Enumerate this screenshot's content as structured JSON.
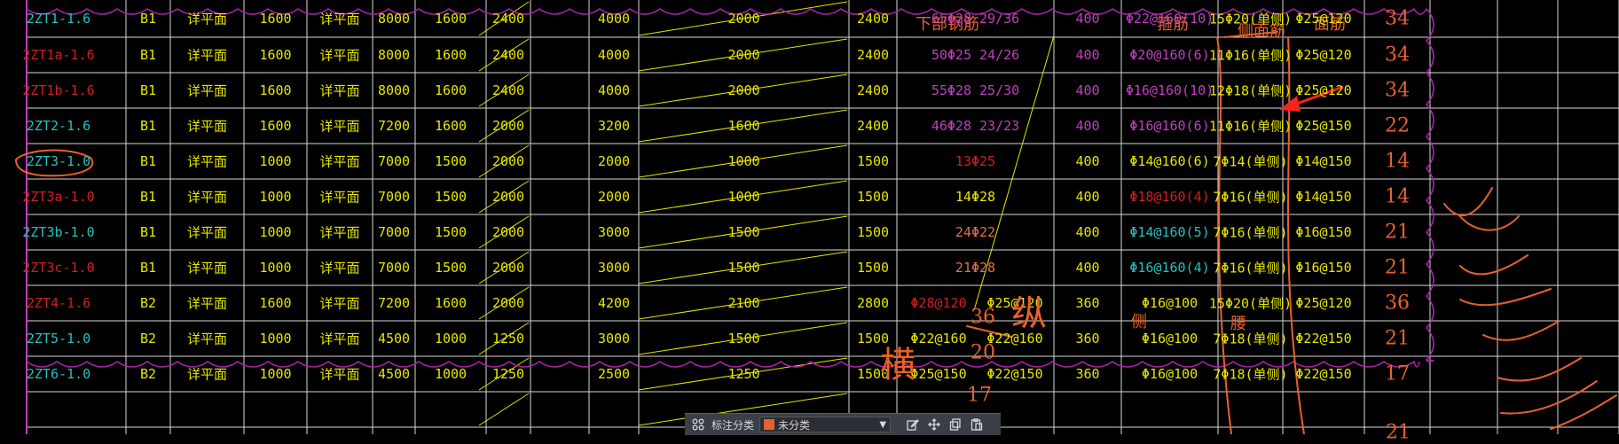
{
  "headers": {
    "lower_rebar": "下部钢筋",
    "stirrups": "箍筋",
    "side_rebar": "侧面筋",
    "face_rebar": "面筋"
  },
  "rows": [
    {
      "name": "2ZT1-1.6",
      "name_color": "#26c0c0",
      "type": "B1",
      "ref1": "详平面",
      "w": "1600",
      "ref2": "详平面",
      "c1": "8000",
      "c2": "1600",
      "c3": "2400",
      "c4": "4000",
      "c5": "2000",
      "c6": "2400",
      "lower": "65Φ28 29/36",
      "lower_color": "#c040c0",
      "c7": "400",
      "stir": "Φ22@160(10)",
      "stir_color": "#c040c0",
      "side": "15Φ20(单侧)",
      "face": "Φ25@120",
      "count": "34"
    },
    {
      "name": "2ZT1a-1.6",
      "name_color": "#d02020",
      "type": "B1",
      "ref1": "详平面",
      "w": "1600",
      "ref2": "详平面",
      "c1": "8000",
      "c2": "1600",
      "c3": "2400",
      "c4": "4000",
      "c5": "2000",
      "c6": "2400",
      "lower": "50Φ25 24/26",
      "lower_color": "#c040c0",
      "c7": "400",
      "stir": "Φ20@160(6)",
      "stir_color": "#c040c0",
      "side": "11Φ16(单侧)",
      "face": "Φ25@120",
      "count": "34"
    },
    {
      "name": "2ZT1b-1.6",
      "name_color": "#d02020",
      "type": "B1",
      "ref1": "详平面",
      "w": "1600",
      "ref2": "详平面",
      "c1": "8000",
      "c2": "1600",
      "c3": "2400",
      "c4": "4000",
      "c5": "2000",
      "c6": "2400",
      "lower": "55Φ28 25/30",
      "lower_color": "#c040c0",
      "c7": "400",
      "stir": "Φ16@160(10)",
      "stir_color": "#c040c0",
      "side": "12Φ18(单侧)",
      "face": "Φ25@120",
      "count": "34"
    },
    {
      "name": "2ZT2-1.6",
      "name_color": "#26c0c0",
      "type": "B1",
      "ref1": "详平面",
      "w": "1600",
      "ref2": "详平面",
      "c1": "7200",
      "c2": "1600",
      "c3": "2000",
      "c4": "3200",
      "c5": "1600",
      "c6": "2400",
      "lower": "46Φ28 23/23",
      "lower_color": "#c040c0",
      "c7": "400",
      "stir": "Φ16@160(6)",
      "stir_color": "#c040c0",
      "side": "11Φ16(单侧)",
      "face": "Φ25@150",
      "count": "22"
    },
    {
      "name": "2ZT3-1.0",
      "name_color": "#26c0c0",
      "type": "B1",
      "ref1": "详平面",
      "w": "1000",
      "ref2": "详平面",
      "c1": "7000",
      "c2": "1500",
      "c3": "2000",
      "c4": "2000",
      "c5": "1000",
      "c6": "1500",
      "lower": "13Φ25",
      "lower_color": "#d02020",
      "c7": "400",
      "stir": "Φ14@160(6)",
      "stir_color": "#e6e600",
      "side": "7Φ14(单侧)",
      "face": "Φ14@150",
      "count": "14"
    },
    {
      "name": "2ZT3a-1.0",
      "name_color": "#d02020",
      "type": "B1",
      "ref1": "详平面",
      "w": "1000",
      "ref2": "详平面",
      "c1": "7000",
      "c2": "1500",
      "c3": "2000",
      "c4": "2000",
      "c5": "1000",
      "c6": "1500",
      "lower": "14Φ28",
      "lower_color": "#e6e600",
      "c7": "400",
      "stir": "Φ18@160(4)",
      "stir_color": "#d02020",
      "side": "7Φ16(单侧)",
      "face": "Φ14@150",
      "count": "14"
    },
    {
      "name": "2ZT3b-1.0",
      "name_color": "#26c0c0",
      "type": "B1",
      "ref1": "详平面",
      "w": "1000",
      "ref2": "详平面",
      "c1": "7000",
      "c2": "1500",
      "c3": "2000",
      "c4": "3000",
      "c5": "1500",
      "c6": "1500",
      "lower": "24Φ22",
      "lower_color": "#e07050",
      "c7": "400",
      "stir": "Φ14@160(5)",
      "stir_color": "#26c0c0",
      "side": "7Φ16(单侧)",
      "face": "Φ16@150",
      "count": "21"
    },
    {
      "name": "2ZT3c-1.0",
      "name_color": "#d02020",
      "type": "B1",
      "ref1": "详平面",
      "w": "1000",
      "ref2": "详平面",
      "c1": "7000",
      "c2": "1500",
      "c3": "2000",
      "c4": "3000",
      "c5": "1500",
      "c6": "1500",
      "lower": "21Φ28",
      "lower_color": "#e07050",
      "c7": "400",
      "stir": "Φ16@160(4)",
      "stir_color": "#26c0c0",
      "side": "7Φ16(单侧)",
      "face": "Φ16@150",
      "count": "21"
    },
    {
      "name": "2ZT4-1.6",
      "name_color": "#d02020",
      "type": "B2",
      "ref1": "详平面",
      "w": "1600",
      "ref2": "详平面",
      "c1": "7200",
      "c2": "1600",
      "c3": "2000",
      "c4": "4200",
      "c5": "2100",
      "c6": "2800",
      "lower": "Φ28@120",
      "lower_color": "#d02020",
      "lower2": "Φ25@120",
      "c7": "360",
      "stir": "Φ16@100",
      "stir_color": "#e6e600",
      "side": "15Φ20(单侧)",
      "face": "Φ25@120",
      "count": "36"
    },
    {
      "name": "2ZT5-1.0",
      "name_color": "#26c0c0",
      "type": "B2",
      "ref1": "详平面",
      "w": "1000",
      "ref2": "详平面",
      "c1": "4500",
      "c2": "1000",
      "c3": "1250",
      "c4": "3000",
      "c5": "1500",
      "c6": "1500",
      "lower": "Φ22@160",
      "lower_color": "#e6e600",
      "lower2": "Φ22@160",
      "c7": "360",
      "stir": "Φ16@100",
      "stir_color": "#e6e600",
      "side": "7Φ18(单侧)",
      "face": "Φ22@150",
      "count": "21"
    },
    {
      "name": "2ZT6-1.0",
      "name_color": "#26c0c0",
      "type": "B2",
      "ref1": "详平面",
      "w": "1000",
      "ref2": "详平面",
      "c1": "4500",
      "c2": "1000",
      "c3": "1250",
      "c4": "2500",
      "c5": "1250",
      "c6": "1500",
      "lower": "Φ25@150",
      "lower_color": "#e6e600",
      "lower2": "Φ22@150",
      "c7": "360",
      "stir": "Φ16@100",
      "stir_color": "#e6e600",
      "side": "7Φ18(单侧)",
      "face": "Φ22@150",
      "count": "17"
    }
  ],
  "handwritten": {
    "num_36": "36",
    "num_20": "20",
    "num_17": "17",
    "char_zong": "纵",
    "char_heng": "横",
    "char_ce": "侧",
    "char_yao": "腰",
    "partial_count": "21"
  },
  "toolbar": {
    "label": "标注分类",
    "select_value": "未分类"
  },
  "colors": {
    "grid": "#d8d8d8",
    "text": "#e6e600",
    "cloud": "#b020b0",
    "markup": "#e8612c",
    "arrow": "#ff2020"
  }
}
